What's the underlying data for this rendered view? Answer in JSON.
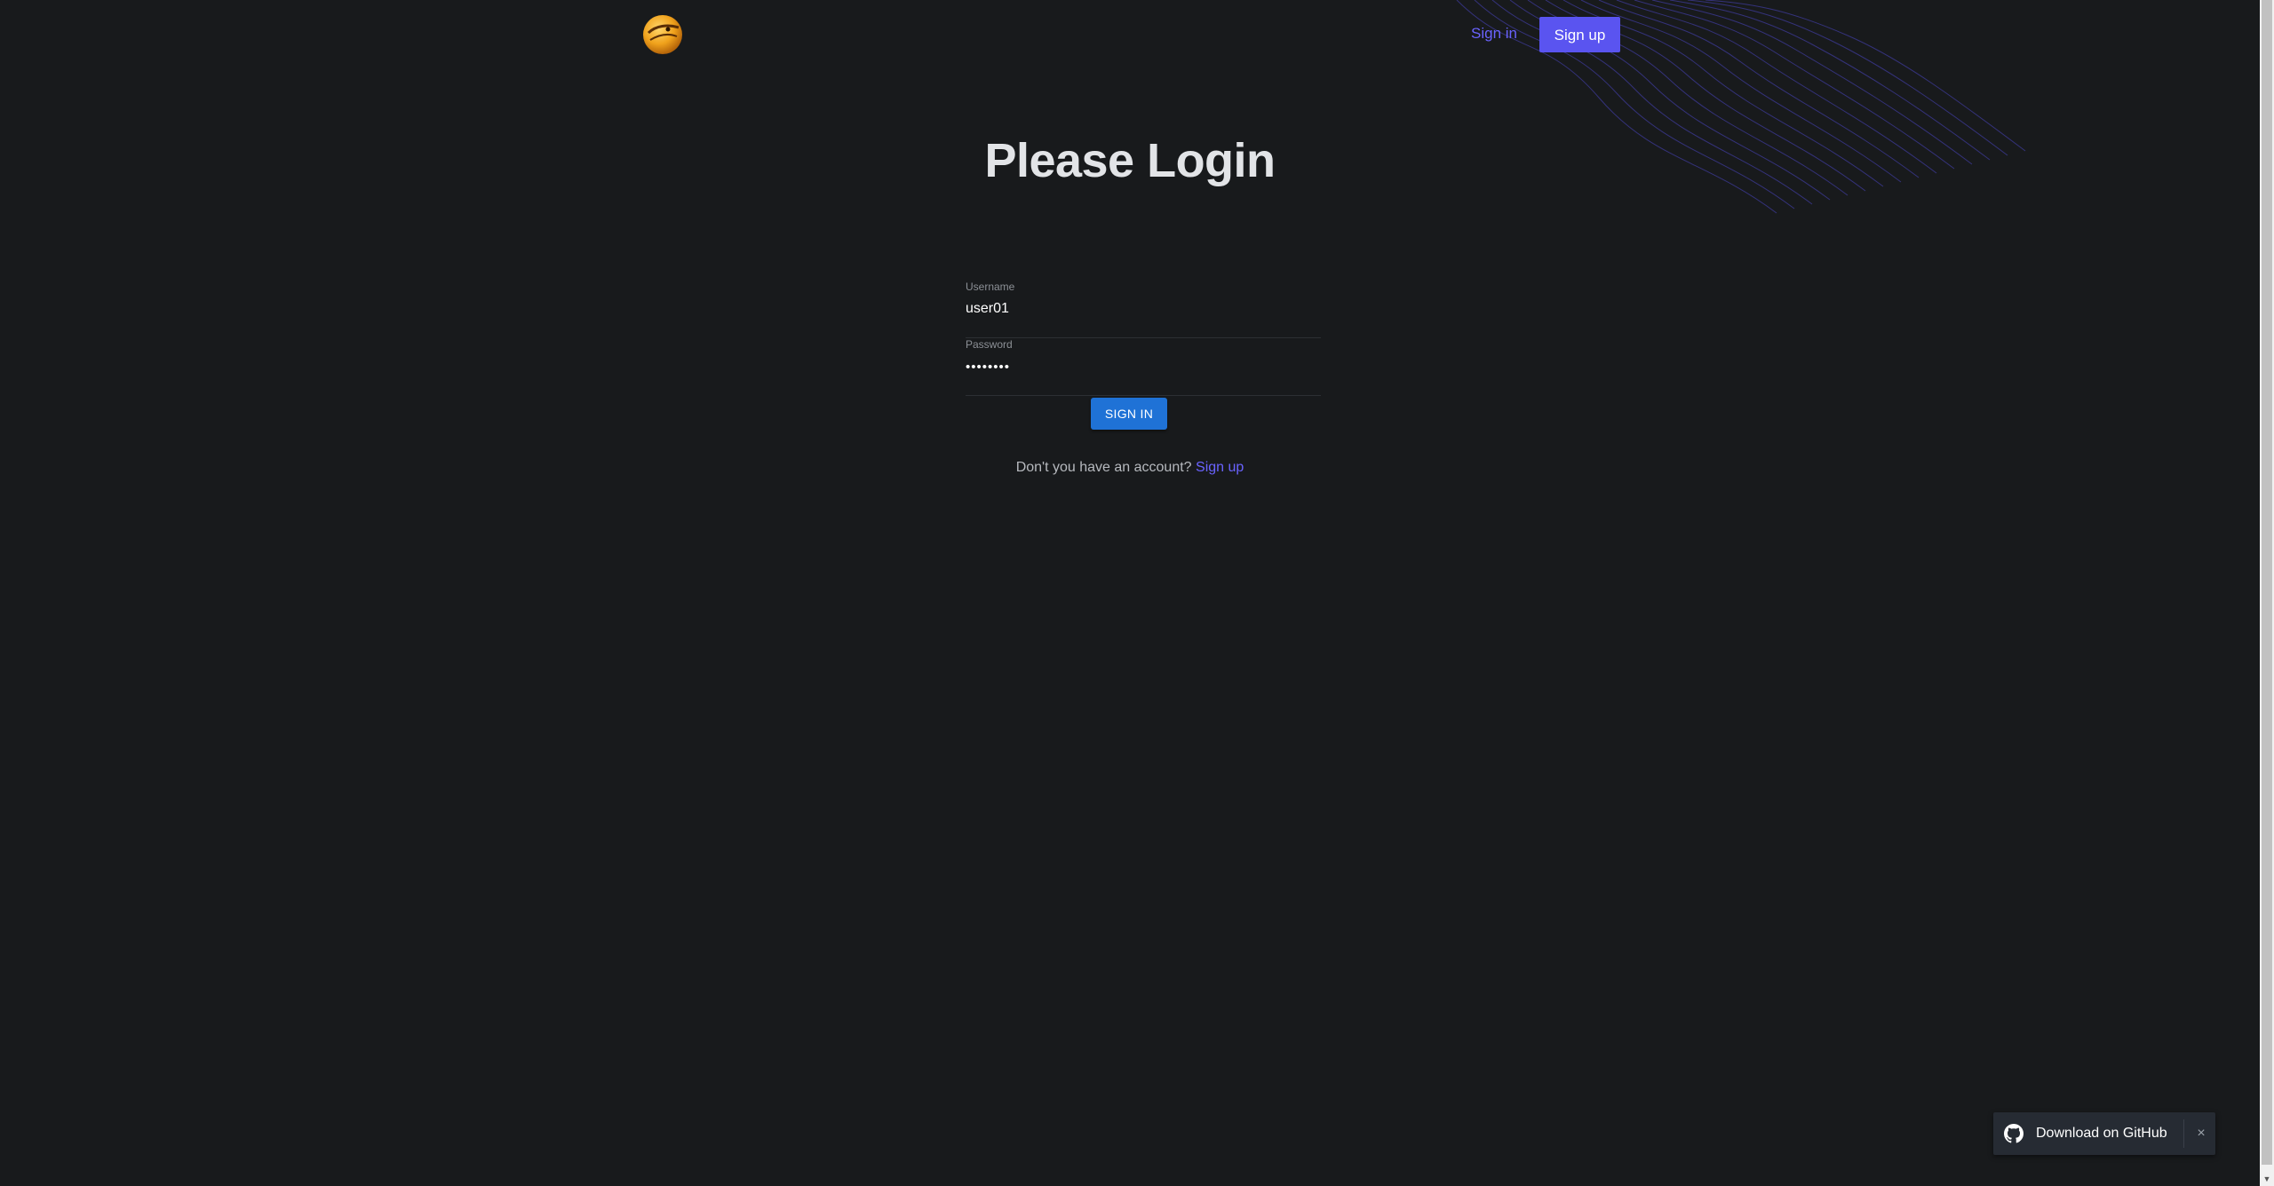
{
  "header": {
    "logo_icon": "hamster-logo-icon",
    "nav_signin_label": "Sign in",
    "nav_signup_label": "Sign up"
  },
  "main": {
    "title": "Please Login",
    "username": {
      "label": "Username",
      "value": "user01"
    },
    "password": {
      "label": "Password",
      "value": "••••••••"
    },
    "signin_button_label": "SIGN IN",
    "account_prompt": "Don't you have an account?",
    "account_link_label": "Sign up"
  },
  "toast": {
    "icon": "github-icon",
    "label": "Download on GitHub",
    "close_icon": "close-icon",
    "close_glyph": "×"
  },
  "colors": {
    "background": "#181a1c",
    "accent": "#5a54f0",
    "link": "#6a63ff",
    "primary_button": "#1f72d6"
  }
}
